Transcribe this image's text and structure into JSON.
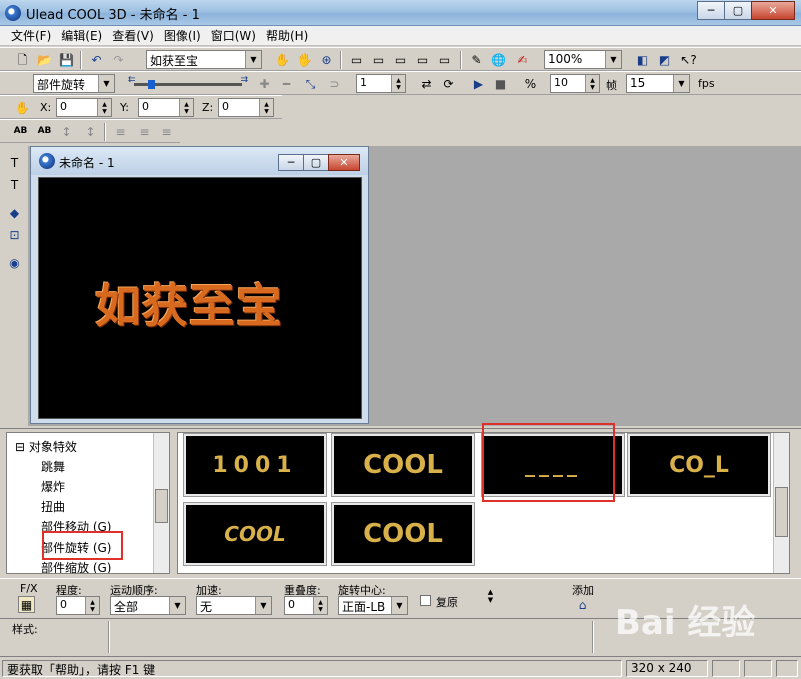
{
  "window": {
    "title": "Ulead COOL 3D - 未命名 - 1",
    "min": "─",
    "max": "▢",
    "close": "✕"
  },
  "menu": [
    "文件(F)",
    "编辑(E)",
    "查看(V)",
    "图像(I)",
    "窗口(W)",
    "帮助(H)"
  ],
  "toolbar1": {
    "text_combo": "如获至宝",
    "zoom": "100%"
  },
  "toolbar2": {
    "effect_combo": "部件旋转",
    "frame": "1",
    "frames_label": "帧",
    "frame_count": "10",
    "fps_value": "15",
    "fps_label": "fps"
  },
  "toolbar3": {
    "x_label": "X:",
    "x": "0",
    "y_label": "Y:",
    "y": "0",
    "z_label": "Z:",
    "z": "0"
  },
  "toolbar4": {
    "ab1": "AB",
    "ab2": "AB"
  },
  "doc": {
    "title": "未命名 - 1",
    "canvas_text": "如获至宝"
  },
  "tree": {
    "root": "对象特效",
    "items": [
      "跳舞",
      "爆炸",
      "扭曲",
      "部件移动 (G)",
      "部件旋转 (G)",
      "部件缩放 (G)"
    ]
  },
  "gallery": {
    "thumbs": [
      "1001",
      "COOL",
      "____",
      "CO_L",
      "COOL",
      "COOL"
    ]
  },
  "props": {
    "fx_label": "F/X",
    "degree_label": "程度:",
    "degree": "0",
    "order_label": "运动顺序:",
    "order": "全部",
    "accel_label": "加速:",
    "accel": "无",
    "overlap_label": "重叠度:",
    "overlap": "0",
    "center_label": "旋转中心:",
    "center": "正面-LB",
    "restore_label": "复原",
    "add_label": "添加"
  },
  "style_label": "样式:",
  "status": {
    "help": "要获取「帮助」，请按 F1 键",
    "size": "320 x 240"
  },
  "watermark": "Bai 经验"
}
